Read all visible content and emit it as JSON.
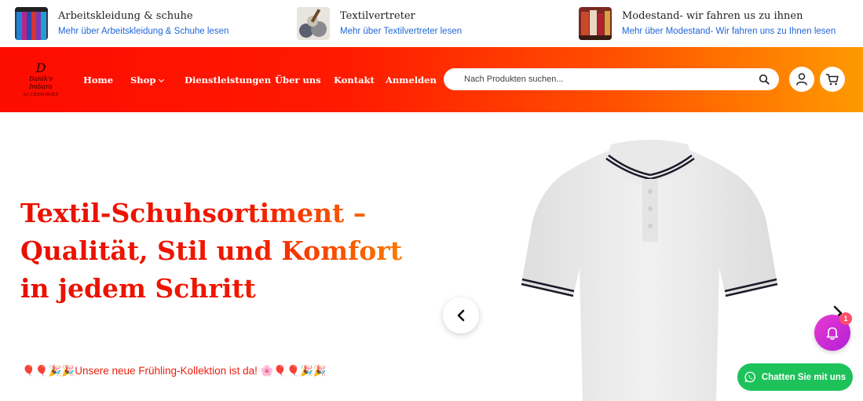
{
  "info_bar": [
    {
      "title": "Arbeitskleidung & schuhe",
      "link": "Mehr über Arbeitskleidung & Schuhe lesen"
    },
    {
      "title": "Textilvertreter",
      "link": "Mehr über Textilvertreter lesen"
    },
    {
      "title": "Modestand- wir fahren us zu ihnen",
      "link": "Mehr über Modestand- Wir fahren uns zu Ihnen lesen"
    }
  ],
  "logo": {
    "monogram": "D",
    "script": "Danik's Imbara",
    "sub": "ACCESSORIES"
  },
  "nav": {
    "home": "Home",
    "shop": "Shop",
    "services": "Dienstleistungen",
    "about": "Über uns",
    "contact": "Kontakt",
    "login": "Anmelden"
  },
  "search": {
    "placeholder": "Nach Produkten suchen..."
  },
  "hero": {
    "title": "Textil-Schuhsortiment – Qualität, Stil und Komfort in jedem Schritt",
    "promo": "🎈🎈🎉🎉Unsere neue Frühling-Kollektion ist da! 🌸🎈🎈🎉🎉"
  },
  "notification": {
    "count": "1"
  },
  "chat": {
    "label": "Chatten Sie mit uns"
  },
  "colors": {
    "header_start": "#fd0c00",
    "header_end": "#ff9a00",
    "link": "#1f66d6",
    "chat": "#1ec25a",
    "bell": "#c12ad6"
  }
}
